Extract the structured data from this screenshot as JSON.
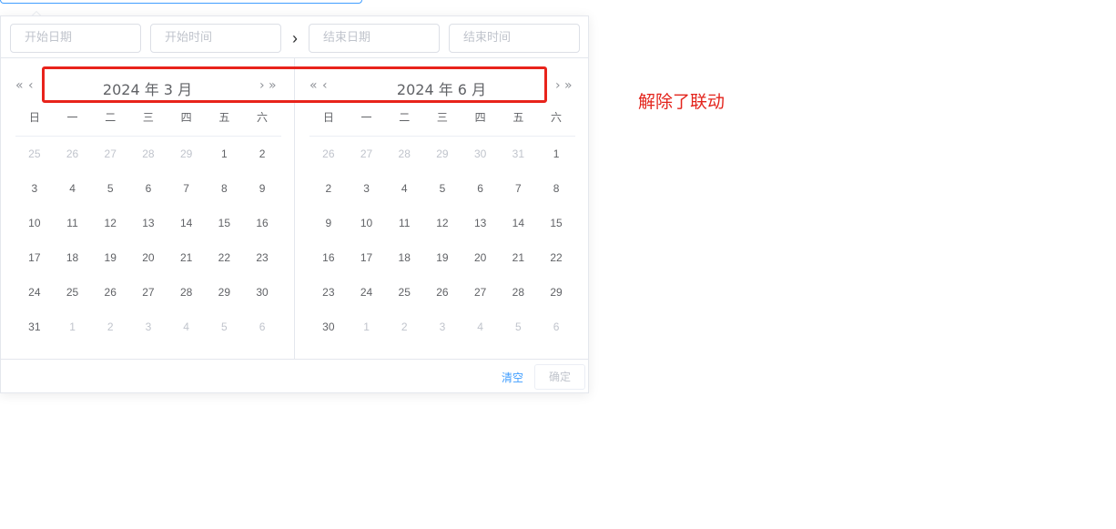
{
  "inputs": {
    "start_date": "开始日期",
    "start_time": "开始时间",
    "end_date": "结束日期",
    "end_time": "结束时间"
  },
  "icons": {
    "separator": "›",
    "prev_year": "«",
    "prev_month": "‹",
    "next_month": "›",
    "next_year": "»"
  },
  "weekdays": [
    "日",
    "一",
    "二",
    "三",
    "四",
    "五",
    "六"
  ],
  "left": {
    "title": "2024 年 3 月",
    "weeks": [
      [
        {
          "d": "25",
          "m": 1
        },
        {
          "d": "26",
          "m": 1
        },
        {
          "d": "27",
          "m": 1
        },
        {
          "d": "28",
          "m": 1
        },
        {
          "d": "29",
          "m": 1
        },
        {
          "d": "1",
          "m": 0
        },
        {
          "d": "2",
          "m": 0
        }
      ],
      [
        {
          "d": "3",
          "m": 0
        },
        {
          "d": "4",
          "m": 0
        },
        {
          "d": "5",
          "m": 0
        },
        {
          "d": "6",
          "m": 0
        },
        {
          "d": "7",
          "m": 0
        },
        {
          "d": "8",
          "m": 0
        },
        {
          "d": "9",
          "m": 0
        }
      ],
      [
        {
          "d": "10",
          "m": 0
        },
        {
          "d": "11",
          "m": 0
        },
        {
          "d": "12",
          "m": 0
        },
        {
          "d": "13",
          "m": 0
        },
        {
          "d": "14",
          "m": 0
        },
        {
          "d": "15",
          "m": 0
        },
        {
          "d": "16",
          "m": 0
        }
      ],
      [
        {
          "d": "17",
          "m": 0
        },
        {
          "d": "18",
          "m": 0
        },
        {
          "d": "19",
          "m": 0
        },
        {
          "d": "20",
          "m": 0
        },
        {
          "d": "21",
          "m": 0
        },
        {
          "d": "22",
          "m": 0
        },
        {
          "d": "23",
          "m": 0
        }
      ],
      [
        {
          "d": "24",
          "m": 0
        },
        {
          "d": "25",
          "m": 0
        },
        {
          "d": "26",
          "m": 0
        },
        {
          "d": "27",
          "m": 0
        },
        {
          "d": "28",
          "m": 0
        },
        {
          "d": "29",
          "m": 0
        },
        {
          "d": "30",
          "m": 0
        }
      ],
      [
        {
          "d": "31",
          "m": 0
        },
        {
          "d": "1",
          "m": 1
        },
        {
          "d": "2",
          "m": 1
        },
        {
          "d": "3",
          "m": 1
        },
        {
          "d": "4",
          "m": 1
        },
        {
          "d": "5",
          "m": 1
        },
        {
          "d": "6",
          "m": 1
        }
      ]
    ]
  },
  "right": {
    "title": "2024 年 6 月",
    "weeks": [
      [
        {
          "d": "26",
          "m": 1
        },
        {
          "d": "27",
          "m": 1
        },
        {
          "d": "28",
          "m": 1
        },
        {
          "d": "29",
          "m": 1
        },
        {
          "d": "30",
          "m": 1
        },
        {
          "d": "31",
          "m": 1
        },
        {
          "d": "1",
          "m": 0
        }
      ],
      [
        {
          "d": "2",
          "m": 0
        },
        {
          "d": "3",
          "m": 0
        },
        {
          "d": "4",
          "m": 0
        },
        {
          "d": "5",
          "m": 0
        },
        {
          "d": "6",
          "m": 0
        },
        {
          "d": "7",
          "m": 0
        },
        {
          "d": "8",
          "m": 0
        }
      ],
      [
        {
          "d": "9",
          "m": 0
        },
        {
          "d": "10",
          "m": 0
        },
        {
          "d": "11",
          "m": 0
        },
        {
          "d": "12",
          "m": 0
        },
        {
          "d": "13",
          "m": 0
        },
        {
          "d": "14",
          "m": 0
        },
        {
          "d": "15",
          "m": 0
        }
      ],
      [
        {
          "d": "16",
          "m": 0
        },
        {
          "d": "17",
          "m": 0
        },
        {
          "d": "18",
          "m": 0
        },
        {
          "d": "19",
          "m": 0
        },
        {
          "d": "20",
          "m": 0
        },
        {
          "d": "21",
          "m": 0
        },
        {
          "d": "22",
          "m": 0
        }
      ],
      [
        {
          "d": "23",
          "m": 0
        },
        {
          "d": "24",
          "m": 0
        },
        {
          "d": "25",
          "m": 0
        },
        {
          "d": "26",
          "m": 0
        },
        {
          "d": "27",
          "m": 0
        },
        {
          "d": "28",
          "m": 0
        },
        {
          "d": "29",
          "m": 0
        }
      ],
      [
        {
          "d": "30",
          "m": 0
        },
        {
          "d": "1",
          "m": 1
        },
        {
          "d": "2",
          "m": 1
        },
        {
          "d": "3",
          "m": 1
        },
        {
          "d": "4",
          "m": 1
        },
        {
          "d": "5",
          "m": 1
        },
        {
          "d": "6",
          "m": 1
        }
      ]
    ]
  },
  "footer": {
    "clear": "清空",
    "confirm": "确定"
  },
  "annotation": "解除了联动",
  "colors": {
    "accent": "#409eff",
    "highlight": "#e8231b",
    "muted": "#c0c4cc",
    "text": "#606266"
  }
}
